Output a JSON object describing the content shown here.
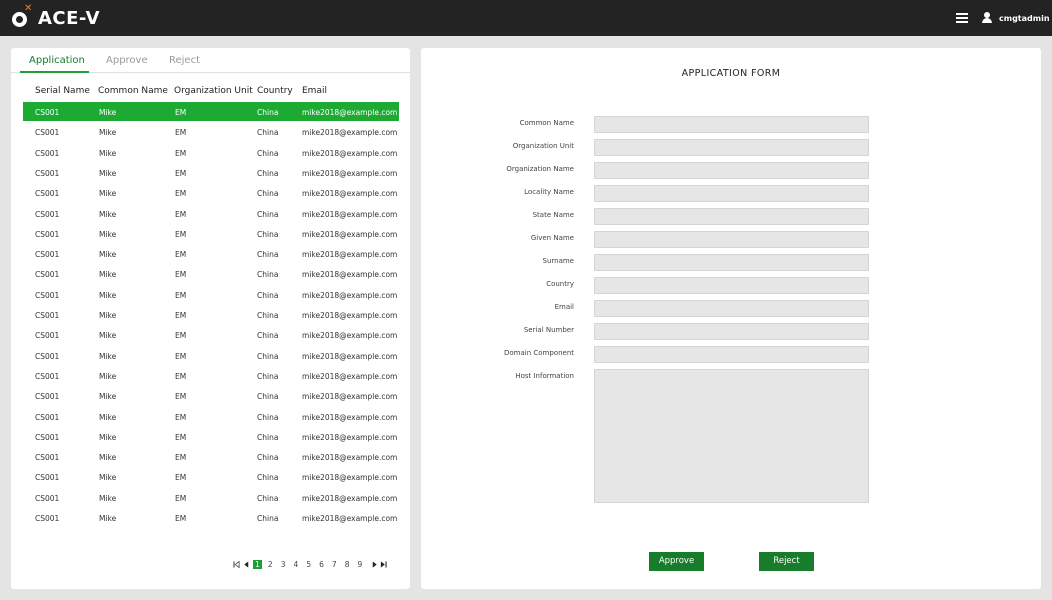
{
  "app": {
    "brand": "ACE-V",
    "username": "cmgtadmin"
  },
  "tabs": [
    "Application",
    "Approve",
    "Reject"
  ],
  "table": {
    "columns": [
      "Serial Name",
      "Common Name",
      "Organization Unit",
      "Country",
      "Email"
    ],
    "rows": [
      [
        "CS001",
        "Mike",
        "EM",
        "China",
        "mike2018@example.com"
      ],
      [
        "CS001",
        "Mike",
        "EM",
        "China",
        "mike2018@example.com"
      ],
      [
        "CS001",
        "Mike",
        "EM",
        "China",
        "mike2018@example.com"
      ],
      [
        "CS001",
        "Mike",
        "EM",
        "China",
        "mike2018@example.com"
      ],
      [
        "CS001",
        "Mike",
        "EM",
        "China",
        "mike2018@example.com"
      ],
      [
        "CS001",
        "Mike",
        "EM",
        "China",
        "mike2018@example.com"
      ],
      [
        "CS001",
        "Mike",
        "EM",
        "China",
        "mike2018@example.com"
      ],
      [
        "CS001",
        "Mike",
        "EM",
        "China",
        "mike2018@example.com"
      ],
      [
        "CS001",
        "Mike",
        "EM",
        "China",
        "mike2018@example.com"
      ],
      [
        "CS001",
        "Mike",
        "EM",
        "China",
        "mike2018@example.com"
      ],
      [
        "CS001",
        "Mike",
        "EM",
        "China",
        "mike2018@example.com"
      ],
      [
        "CS001",
        "Mike",
        "EM",
        "China",
        "mike2018@example.com"
      ],
      [
        "CS001",
        "Mike",
        "EM",
        "China",
        "mike2018@example.com"
      ],
      [
        "CS001",
        "Mike",
        "EM",
        "China",
        "mike2018@example.com"
      ],
      [
        "CS001",
        "Mike",
        "EM",
        "China",
        "mike2018@example.com"
      ],
      [
        "CS001",
        "Mike",
        "EM",
        "China",
        "mike2018@example.com"
      ],
      [
        "CS001",
        "Mike",
        "EM",
        "China",
        "mike2018@example.com"
      ],
      [
        "CS001",
        "Mike",
        "EM",
        "China",
        "mike2018@example.com"
      ],
      [
        "CS001",
        "Mike",
        "EM",
        "China",
        "mike2018@example.com"
      ],
      [
        "CS001",
        "Mike",
        "EM",
        "China",
        "mike2018@example.com"
      ],
      [
        "CS001",
        "Mike",
        "EM",
        "China",
        "mike2018@example.com"
      ]
    ]
  },
  "pagination": {
    "current": "1",
    "pages": [
      "1",
      "2",
      "3",
      "4",
      "5",
      "6",
      "7",
      "8",
      "9"
    ]
  },
  "form": {
    "title": "APPLICATION FORM",
    "fields": [
      "Common Name",
      "Organization Unit",
      "Organization Name",
      "Locality Name",
      "State Name",
      "Given Name",
      "Surname",
      "Country",
      "Email",
      "Serial Number",
      "Domain Component"
    ],
    "textarea_label": "Host Information",
    "approve_label": "Approve",
    "reject_label": "Reject"
  },
  "colors": {
    "accent": "#1caa32",
    "button": "#187d2a",
    "topbar": "#232323",
    "logo_x": "#ff7a00"
  },
  "icons": [
    "logo-icon",
    "menu-icon",
    "user-icon",
    "first-page-icon",
    "prev-page-icon",
    "next-page-icon",
    "last-page-icon"
  ]
}
